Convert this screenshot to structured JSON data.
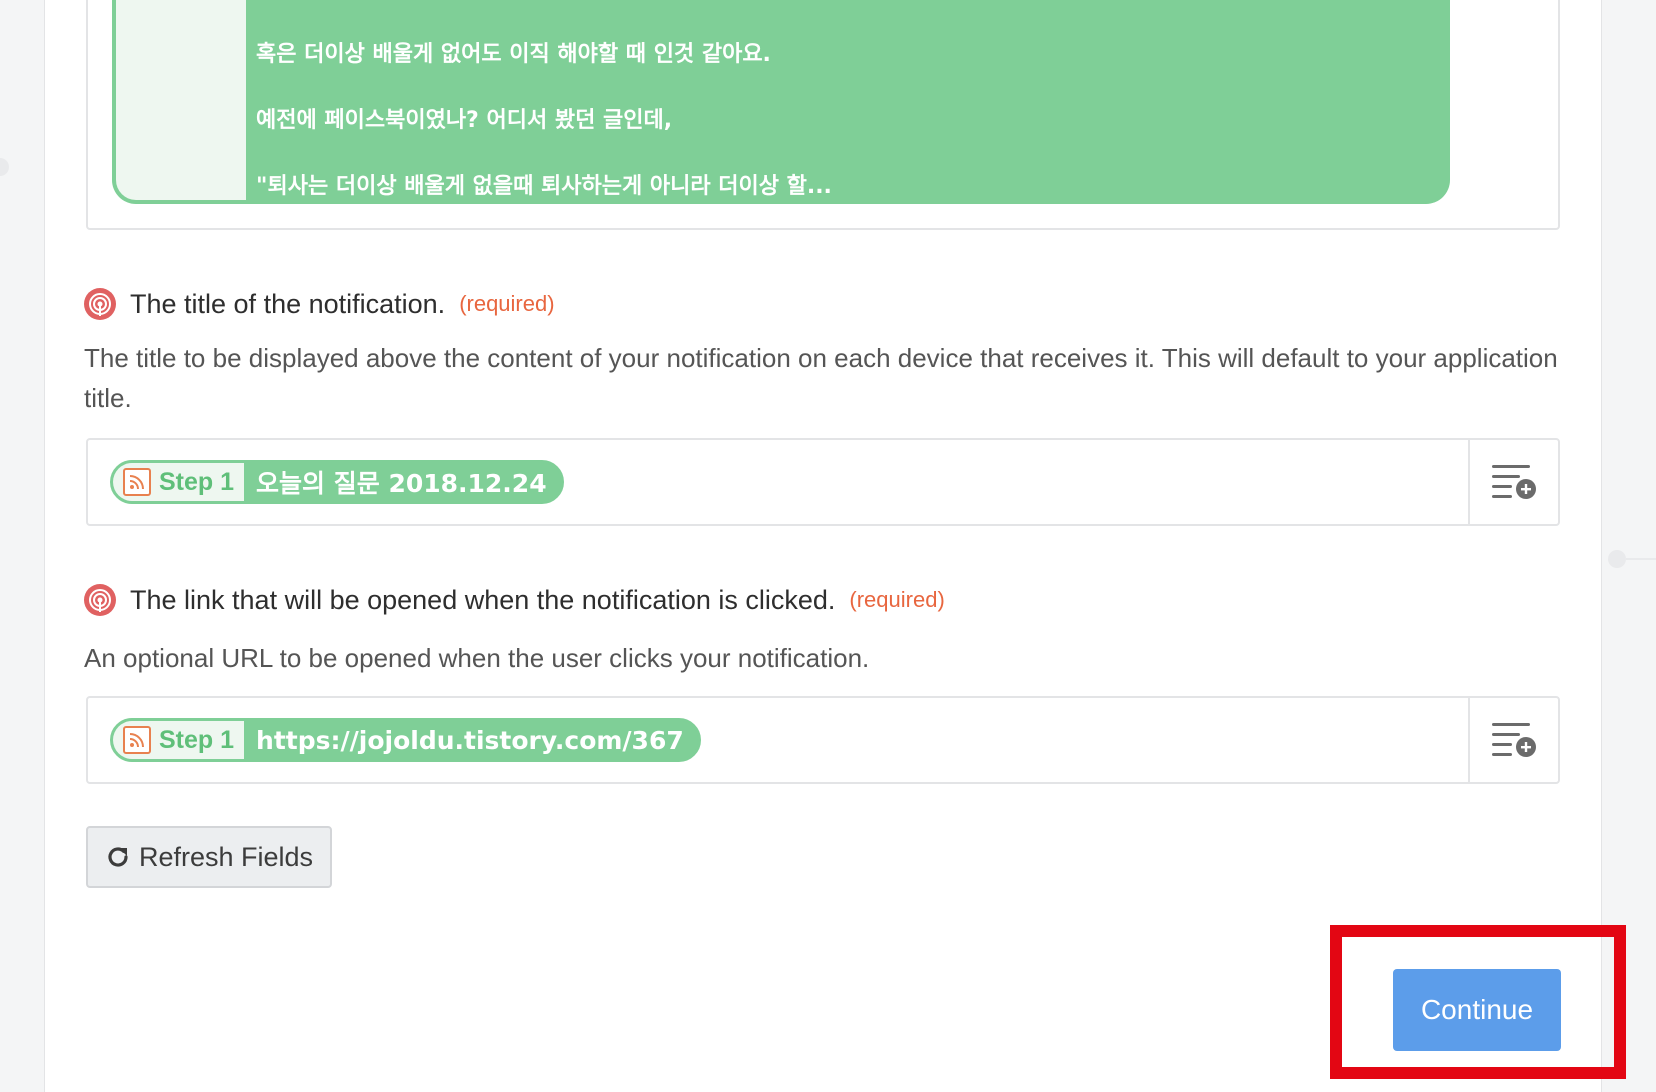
{
  "preview": {
    "lines": [
      "혹은 더이상 배울게 없어도 이직 해야할 때 인것 같아요.",
      "예전에 페이스북이였나? 어디서 봤던 글인데,",
      "\"퇴사는 더이상 배울게 없을때 퇴사하는게 아니라 더이상 할..."
    ]
  },
  "title_field": {
    "label": "The title of the notification.",
    "required": "(required)",
    "help": "The title to be displayed above the content of your notification on each device that receives it. This will default to your application title.",
    "token_step": "Step 1",
    "token_value": "오늘의 질문 2018.12.24",
    "icon": "broadcast-icon"
  },
  "link_field": {
    "label": "The link that will be opened when the notification is clicked.",
    "required": "(required)",
    "help": "An optional URL to be opened when the user clicks your notification.",
    "token_step": "Step 1",
    "token_value": "https://jojoldu.tistory.com/367",
    "icon": "broadcast-icon"
  },
  "actions": {
    "refresh_label": "Refresh Fields",
    "continue_label": "Continue"
  },
  "colors": {
    "token_green": "#7fcf97",
    "required_orange": "#e8663f",
    "continue_blue": "#5c9dea",
    "highlight_red": "#e30613"
  }
}
